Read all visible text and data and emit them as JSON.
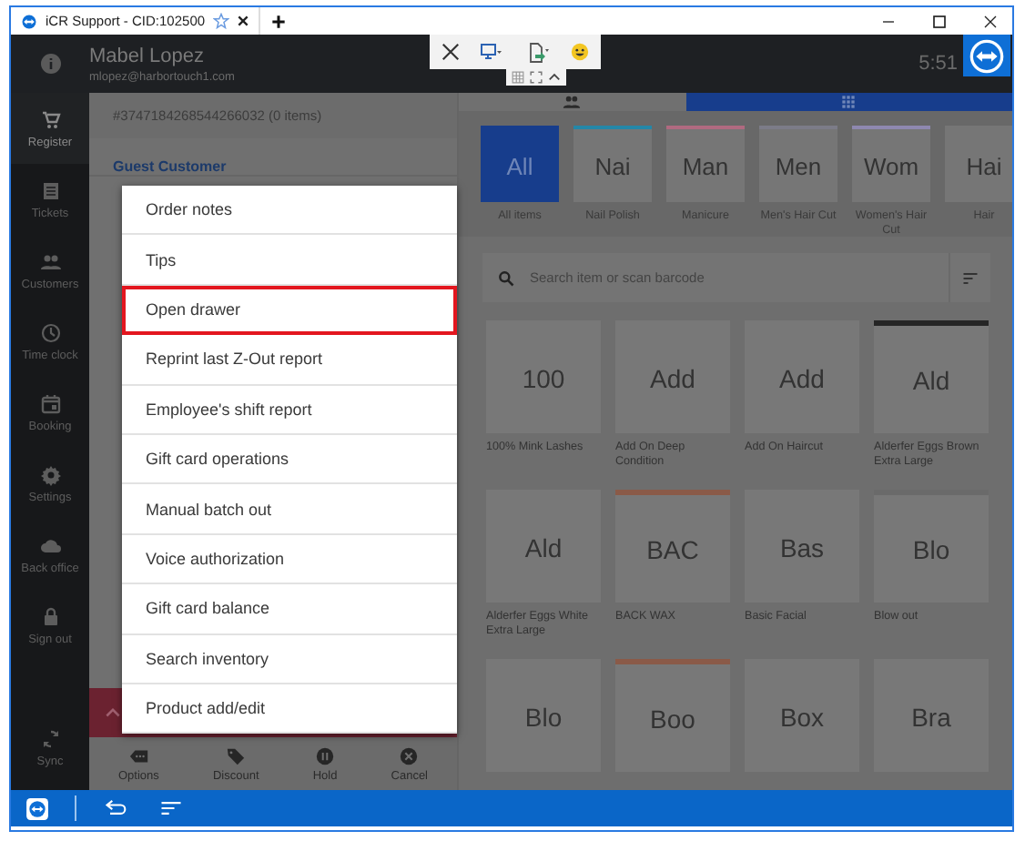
{
  "browser_tab": {
    "title": "iCR Support - CID:102500"
  },
  "header": {
    "user_name": "Mabel Lopez",
    "user_email": "mlopez@harbortouch1.com",
    "time": "5:51"
  },
  "sidebar": {
    "items": [
      {
        "label": "Register",
        "kind": "cart",
        "selected": true
      },
      {
        "label": "Tickets",
        "kind": "list",
        "selected": false
      },
      {
        "label": "Customers",
        "kind": "people",
        "selected": false
      },
      {
        "label": "Time clock",
        "kind": "clock",
        "selected": false
      },
      {
        "label": "Booking",
        "kind": "calendar",
        "selected": false
      },
      {
        "label": "Settings",
        "kind": "gear",
        "selected": false
      },
      {
        "label": "Back office",
        "kind": "cloud",
        "selected": false
      },
      {
        "label": "Sign out",
        "kind": "lock",
        "selected": false
      }
    ],
    "footer": {
      "label": "Sync",
      "kind": "sync"
    }
  },
  "ticket": {
    "title": "#3747184268544266032 (0 items)",
    "customer": "Guest Customer",
    "actions": [
      {
        "label": "Options",
        "kind": "options"
      },
      {
        "label": "Discount",
        "kind": "tag"
      },
      {
        "label": "Hold",
        "kind": "pause"
      },
      {
        "label": "Cancel",
        "kind": "cancel"
      }
    ]
  },
  "view_tabs": [
    {
      "kind": "people",
      "selected": false
    },
    {
      "kind": "grid",
      "selected": true
    }
  ],
  "categories": [
    {
      "code": "All",
      "label": "All items",
      "selected": true
    },
    {
      "code": "Nai",
      "label": "Nail Polish",
      "selected": false,
      "color": "#2487a8"
    },
    {
      "code": "Man",
      "label": "Manicure",
      "selected": false,
      "color": "#b06a80"
    },
    {
      "code": "Men",
      "label": "Men's Hair Cut",
      "selected": false,
      "color": "#7c7c88"
    },
    {
      "code": "Wom",
      "label": "Women's Hair Cut",
      "selected": false,
      "color": "#8e88b0"
    },
    {
      "code": "Hai",
      "label": "Hair",
      "selected": false
    }
  ],
  "search": {
    "placeholder": "Search item or scan barcode"
  },
  "products": [
    {
      "code": "100",
      "name": "100% Mink Lashes"
    },
    {
      "code": "Add",
      "name": "Add On Deep Condition"
    },
    {
      "code": "Add",
      "name": "Add On Haircut"
    },
    {
      "code": "Ald",
      "name": "Alderfer Eggs Brown Extra Large",
      "color": "#252525"
    },
    {
      "code": "Ald",
      "name": "Alderfer Eggs White Extra Large"
    },
    {
      "code": "BAC",
      "name": "BACK WAX",
      "color": "#8a5a48"
    },
    {
      "code": "Bas",
      "name": "Basic Facial"
    },
    {
      "code": "Blo",
      "name": "Blow out",
      "color": "#6a6a6a"
    },
    {
      "code": "Blo"
    },
    {
      "code": "Boo",
      "color": "#8a5a48"
    },
    {
      "code": "Box"
    },
    {
      "code": "Bra"
    }
  ],
  "menu": {
    "items": [
      {
        "label": "Order notes",
        "highlighted": false
      },
      {
        "label": "Tips",
        "highlighted": false
      },
      {
        "label": "Open drawer",
        "highlighted": true
      },
      {
        "label": "Reprint last Z-Out report",
        "highlighted": false
      },
      {
        "label": "Employee's shift report",
        "highlighted": false
      },
      {
        "label": "Gift card operations",
        "highlighted": false
      },
      {
        "label": "Manual batch out",
        "highlighted": false
      },
      {
        "label": "Voice authorization",
        "highlighted": false
      },
      {
        "label": "Gift card balance",
        "highlighted": false
      },
      {
        "label": "Search inventory",
        "highlighted": false
      },
      {
        "label": "Product add/edit",
        "highlighted": false
      }
    ]
  }
}
